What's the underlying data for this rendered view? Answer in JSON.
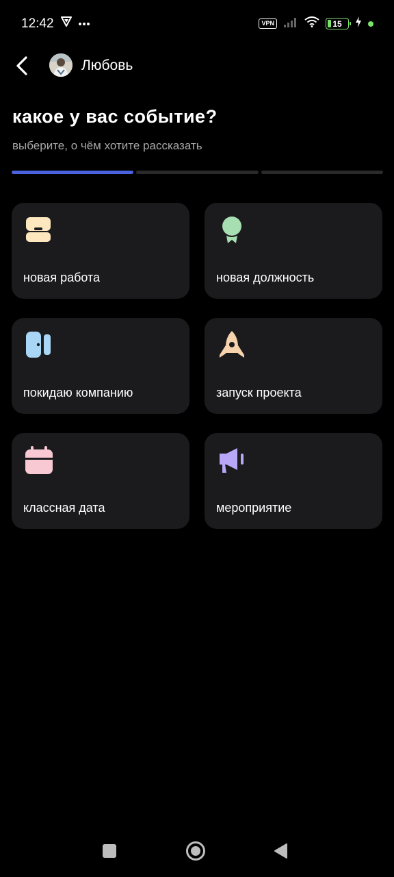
{
  "status_bar": {
    "time": "12:42",
    "vpn": "VPN",
    "battery": "15"
  },
  "header": {
    "user_name": "Любовь"
  },
  "page": {
    "title": "какое у вас событие?",
    "subtitle": "выберите, о чём хотите рассказать",
    "progress": {
      "current_step": 1,
      "total_steps": 3
    }
  },
  "events": [
    {
      "label": "новая работа",
      "icon": "briefcase-icon",
      "color": "#fce7bf"
    },
    {
      "label": "новая должность",
      "icon": "medal-icon",
      "color": "#a7dfb2"
    },
    {
      "label": "покидаю компанию",
      "icon": "door-icon",
      "color": "#a9d6f5"
    },
    {
      "label": "запуск проекта",
      "icon": "rocket-icon",
      "color": "#f6d3ad"
    },
    {
      "label": "классная дата",
      "icon": "calendar-icon",
      "color": "#f8c8d3"
    },
    {
      "label": "мероприятие",
      "icon": "megaphone-icon",
      "color": "#b8a6f7"
    }
  ],
  "colors": {
    "background": "#000000",
    "card": "#1b1b1d",
    "accent": "#4a62e0",
    "battery": "#7be36b"
  }
}
